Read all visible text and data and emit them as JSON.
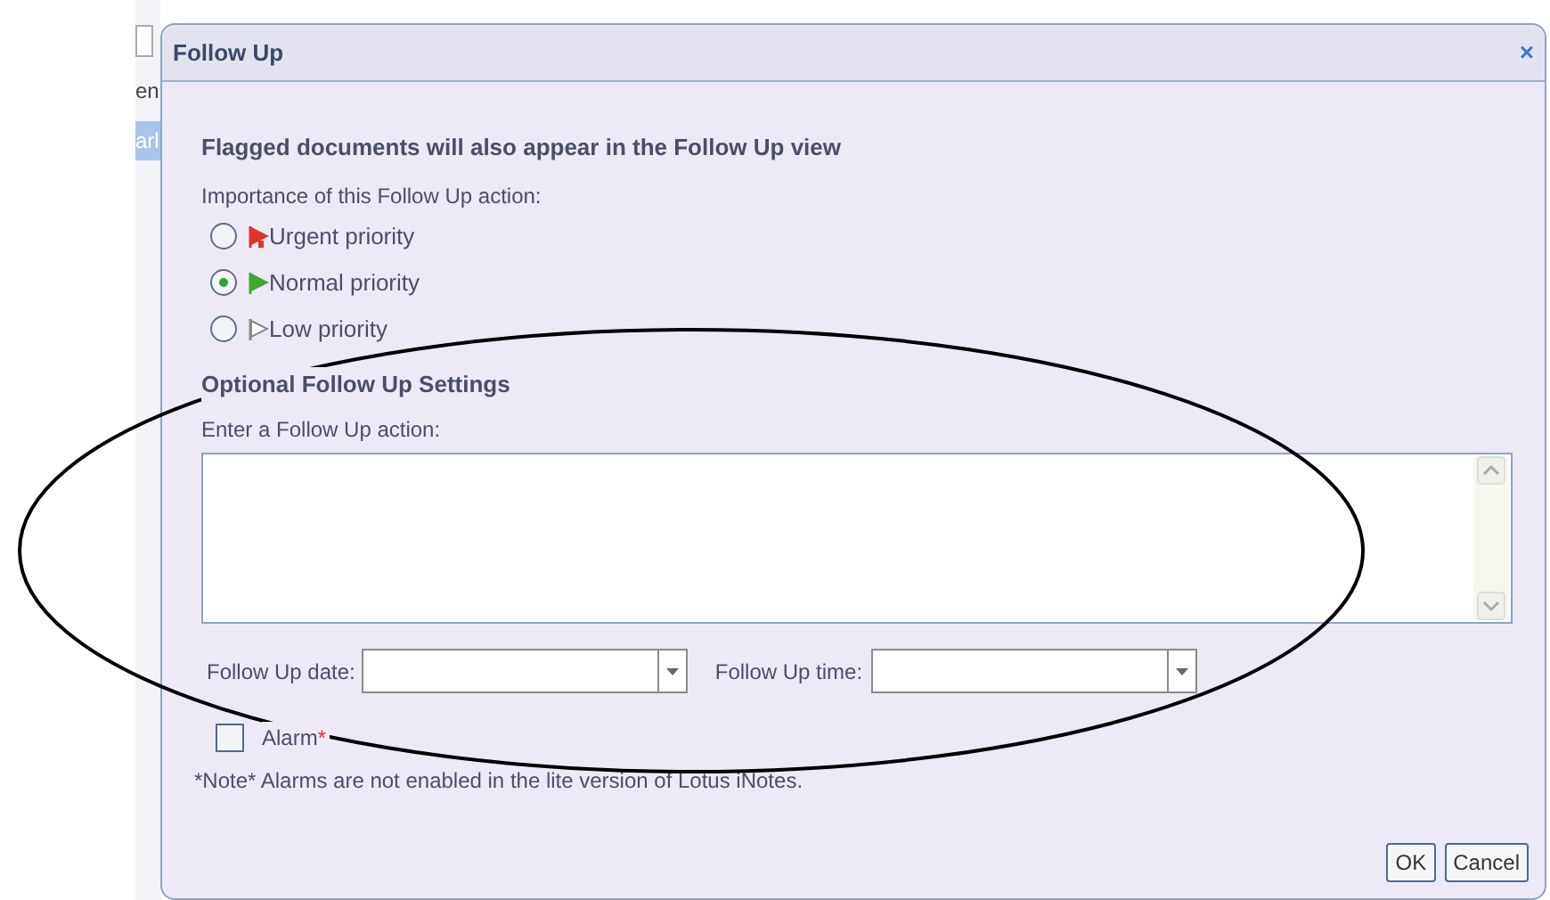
{
  "background_app": {
    "texts": [
      "en",
      "arl"
    ]
  },
  "dialog": {
    "title": "Follow Up",
    "close": "×",
    "heading": "Flagged documents will also appear in the Follow Up view",
    "importance_label": "Importance of this Follow Up action:",
    "priorities": [
      {
        "label": "Urgent priority",
        "kind": "urgent",
        "selected": false
      },
      {
        "label": "Normal priority",
        "kind": "normal",
        "selected": true
      },
      {
        "label": "Low priority",
        "kind": "low",
        "selected": false
      }
    ],
    "optional_heading": "Optional Follow Up Settings",
    "action_label": "Enter a Follow Up action:",
    "date_label": "Follow Up date:",
    "time_label": "Follow Up time:",
    "alarm": {
      "label": "Alarm",
      "required_mark": "*",
      "checked": false
    },
    "note": "*Note* Alarms are not enabled in the lite version of Lotus iNotes.",
    "buttons": [
      "OK",
      "Cancel"
    ]
  },
  "annotation": {
    "kind": "ellipse"
  }
}
